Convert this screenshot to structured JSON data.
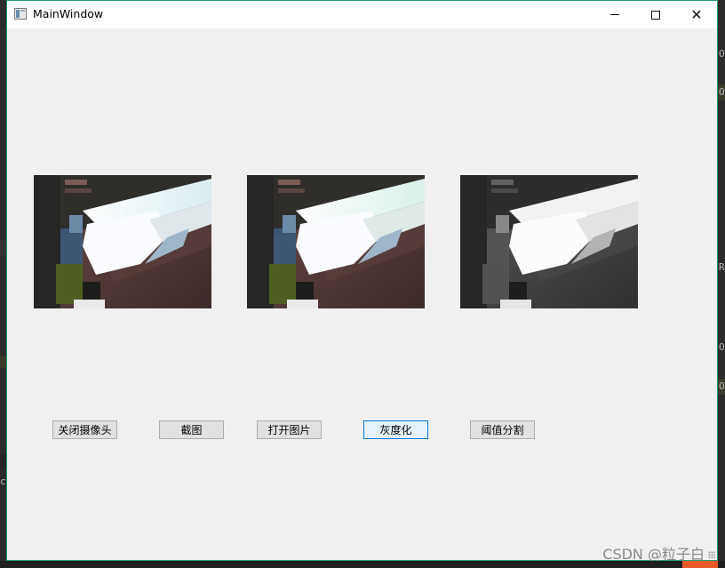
{
  "window": {
    "title": "MainWindow",
    "controls": {
      "minimize": "minimize-icon",
      "maximize": "maximize-icon",
      "close": "close-icon",
      "close_glyph": "✕"
    }
  },
  "images": [
    {
      "kind": "camera-feed-original"
    },
    {
      "kind": "camera-feed-capture"
    },
    {
      "kind": "camera-feed-grayscale"
    }
  ],
  "buttons": [
    {
      "label": "关闭摄像头",
      "focused": false
    },
    {
      "label": "截图",
      "focused": false
    },
    {
      "label": "打开图片",
      "focused": false
    },
    {
      "label": "灰度化",
      "focused": true
    },
    {
      "label": "阈值分割",
      "focused": false
    }
  ],
  "watermark": "CSDN @粒子白",
  "background_marks": {
    "right": [
      "O",
      "O",
      "R",
      "O",
      "O"
    ],
    "left": [
      "c"
    ]
  },
  "colors": {
    "window_bg": "#f0f0f0",
    "border_accent": "#1e9e74",
    "focus_accent": "#0078d7"
  }
}
